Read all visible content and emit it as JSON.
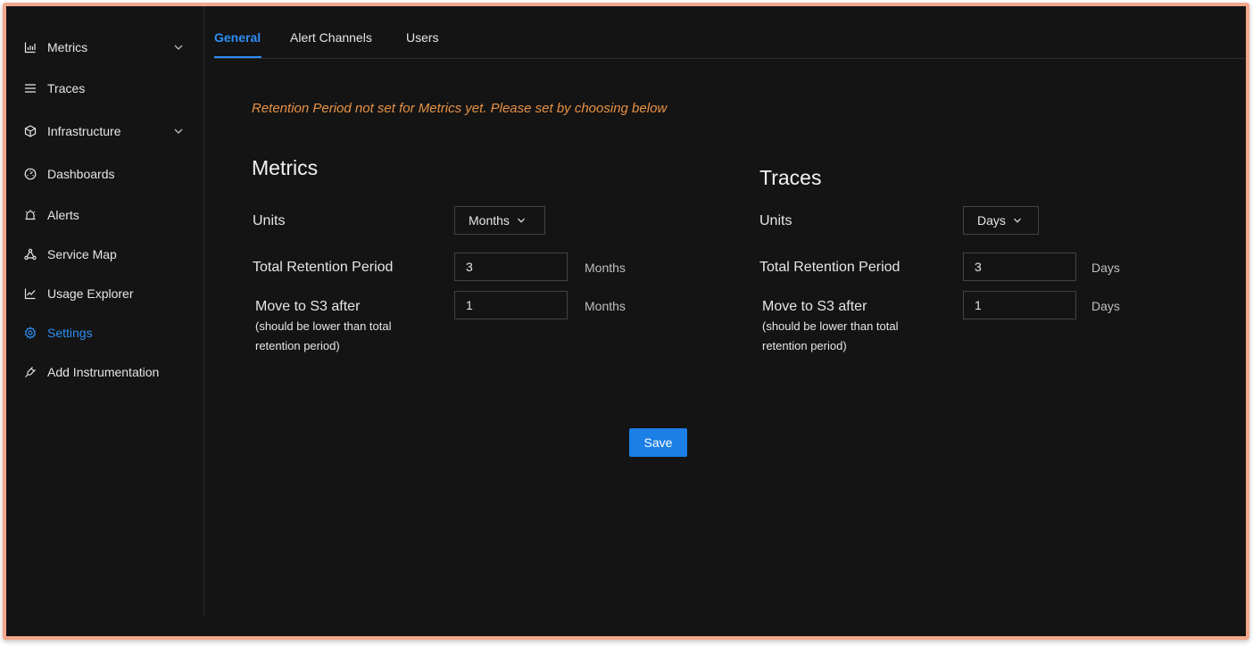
{
  "sidebar": {
    "items": [
      {
        "label": "Metrics",
        "icon": "bar-chart-icon",
        "has_chevron": true
      },
      {
        "label": "Traces",
        "icon": "list-icon",
        "has_chevron": false
      },
      {
        "label": "Infrastructure",
        "icon": "cube-icon",
        "has_chevron": true
      },
      {
        "label": "Dashboards",
        "icon": "dashboard-icon",
        "has_chevron": false
      },
      {
        "label": "Alerts",
        "icon": "alarm-icon",
        "has_chevron": false
      },
      {
        "label": "Service Map",
        "icon": "network-icon",
        "has_chevron": false
      },
      {
        "label": "Usage Explorer",
        "icon": "line-chart-icon",
        "has_chevron": false
      },
      {
        "label": "Settings",
        "icon": "gear-icon",
        "has_chevron": false,
        "active": true
      },
      {
        "label": "Add Instrumentation",
        "icon": "plug-icon",
        "has_chevron": false
      }
    ]
  },
  "tabs": [
    {
      "label": "General",
      "active": true
    },
    {
      "label": "Alert Channels",
      "active": false
    },
    {
      "label": "Users",
      "active": false
    }
  ],
  "notice": "Retention Period not set for Metrics yet. Please set by choosing below",
  "metrics": {
    "title": "Metrics",
    "units_label": "Units",
    "units_value": "Months",
    "total_label": "Total Retention Period",
    "total_value": "3",
    "total_unit": "Months",
    "move_label": "Move to  S3 after",
    "move_hint": "(should be lower than total retention period)",
    "move_value": "1",
    "move_unit": "Months"
  },
  "traces": {
    "title": "Traces",
    "units_label": "Units",
    "units_value": "Days",
    "total_label": "Total Retention Period",
    "total_value": "3",
    "total_unit": "Days",
    "move_label": "Move to S3 after",
    "move_hint": "(should be lower than total retention period)",
    "move_value": "1",
    "move_unit": "Days"
  },
  "save_label": "Save",
  "colors": {
    "background": "#141414",
    "accent": "#2f8ef5",
    "warning": "#e89245",
    "button": "#1b7fe6",
    "frame_border": "#f3a78a"
  }
}
